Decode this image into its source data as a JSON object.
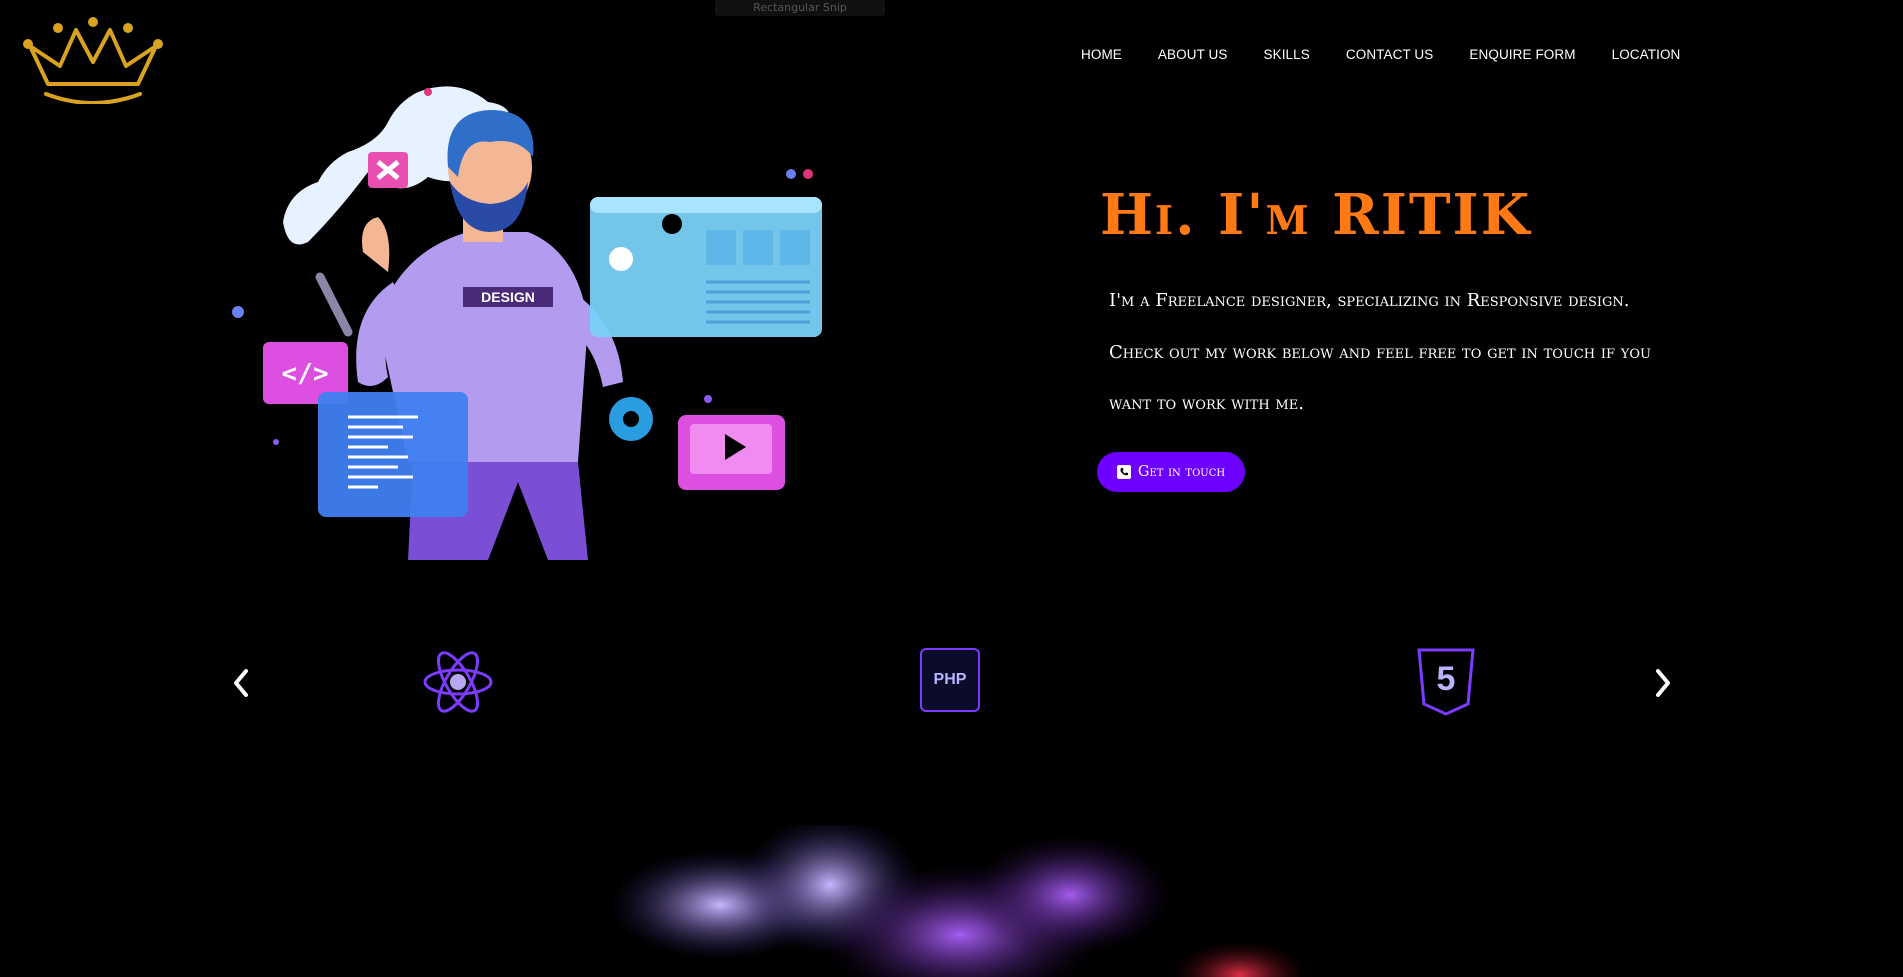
{
  "snip_bar": {
    "label": "Rectangular Snip"
  },
  "nav": {
    "items": [
      {
        "label": "HOME"
      },
      {
        "label": "ABOUT US"
      },
      {
        "label": "SKILLS"
      },
      {
        "label": "CONTACT US"
      },
      {
        "label": "ENQUIRE FORM"
      },
      {
        "label": "LOCATION"
      }
    ]
  },
  "hero": {
    "title": "Hi. I'm RITIK",
    "line1": "I'm a Freelance designer, specializing in Responsive design.",
    "line2": "Check out my work below and feel free to get in touch if you",
    "line3": "want to work with me.",
    "cta_label": "Get in touch",
    "illustration_shirt_text": "DESIGN"
  },
  "skills": {
    "items": [
      {
        "icon": "react-icon"
      },
      {
        "icon": "php-icon",
        "label": "PHP"
      },
      {
        "icon": "html5-icon",
        "label": "5"
      }
    ]
  },
  "colors": {
    "background": "#000000",
    "title": "#ff7a14",
    "accent": "#6d00ff",
    "logo": "#d9a321",
    "skill_icon": "#7b3cff"
  }
}
